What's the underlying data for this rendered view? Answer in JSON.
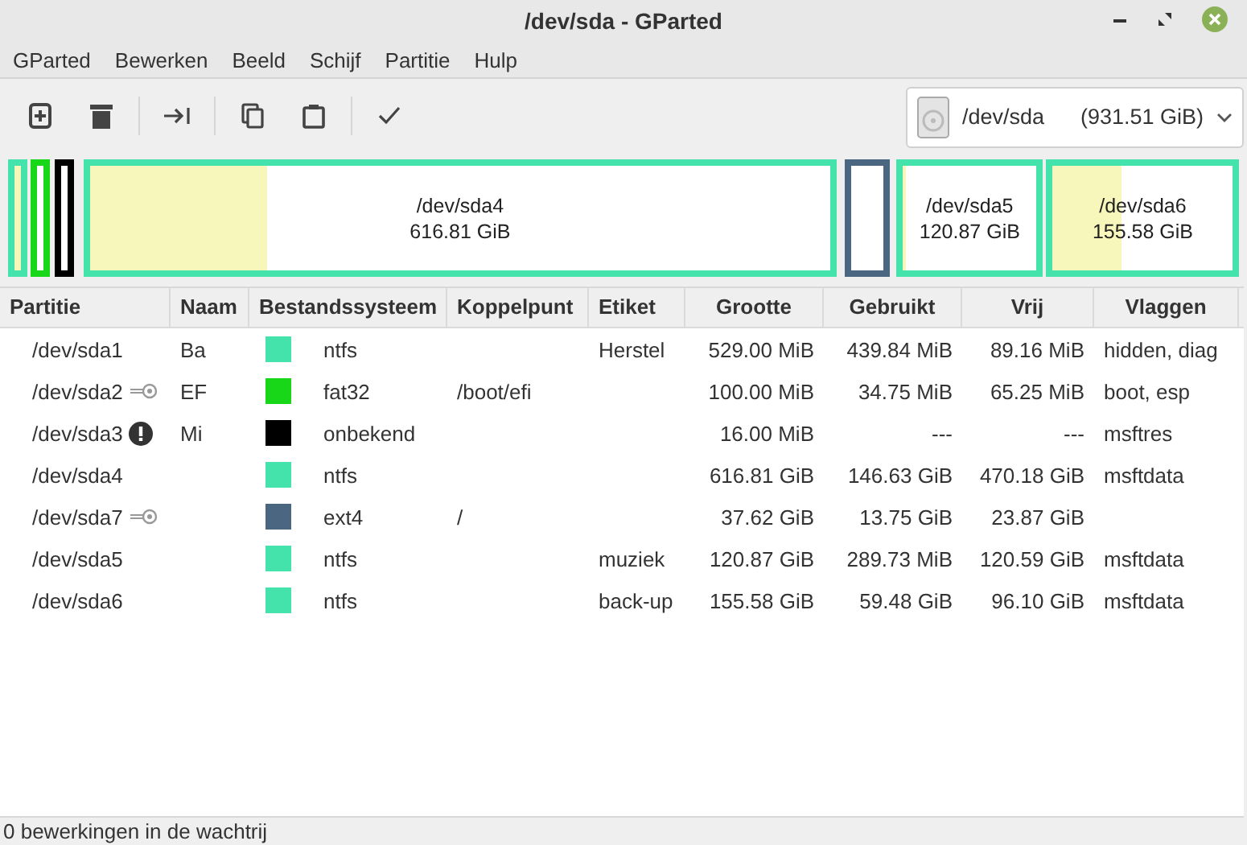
{
  "window": {
    "title": "/dev/sda - GParted"
  },
  "menu": [
    "GParted",
    "Bewerken",
    "Beeld",
    "Schijf",
    "Partitie",
    "Hulp"
  ],
  "device": {
    "name": "/dev/sda",
    "size": "(931.51 GiB)"
  },
  "disk_map": [
    {
      "color": "#43e3ab",
      "level": 1
    },
    {
      "color": "#18d718"
    },
    {
      "color": "#000000"
    },
    {
      "color": "#43e3ab",
      "level": 0.24,
      "name": "/dev/sda4",
      "size": "616.81 GiB"
    },
    {
      "color": "#4a6680"
    },
    {
      "color": "#43e3ab",
      "level": 0.02,
      "name": "/dev/sda5",
      "size": "120.87 GiB"
    },
    {
      "color": "#43e3ab",
      "level": 0.38,
      "name": "/dev/sda6",
      "size": "155.58 GiB"
    }
  ],
  "table": {
    "columns": [
      "Partitie",
      "Naam",
      "Bestandssysteem",
      "Koppelpunt",
      "Etiket",
      "Grootte",
      "Gebruikt",
      "Vrij",
      "Vlaggen"
    ],
    "rows": [
      {
        "partition": "/dev/sda1",
        "mounted": false,
        "warning": false,
        "name": "Ba",
        "color": "#43e3ab",
        "filesystem": "ntfs",
        "label": "Herstel",
        "size": "529.00 MiB",
        "used": "439.84 MiB",
        "free": "89.16 MiB",
        "flags": "hidden, diag"
      },
      {
        "partition": "/dev/sda2",
        "mounted": true,
        "warning": false,
        "name": "EF",
        "color": "#18d718",
        "filesystem": "fat32",
        "mountpoint": "/boot/efi",
        "size": "100.00 MiB",
        "used": "34.75 MiB",
        "free": "65.25 MiB",
        "flags": "boot, esp"
      },
      {
        "partition": "/dev/sda3",
        "mounted": false,
        "warning": true,
        "name": "Mi",
        "color": "#000000",
        "filesystem": "onbekend",
        "size": "16.00 MiB",
        "used": "---",
        "free": "---",
        "flags": "msftres"
      },
      {
        "partition": "/dev/sda4",
        "mounted": false,
        "warning": false,
        "color": "#43e3ab",
        "filesystem": "ntfs",
        "size": "616.81 GiB",
        "used": "146.63 GiB",
        "free": "470.18 GiB",
        "flags": "msftdata"
      },
      {
        "partition": "/dev/sda7",
        "mounted": true,
        "warning": false,
        "color": "#4a6680",
        "filesystem": "ext4",
        "mountpoint": "/",
        "size": "37.62 GiB",
        "used": "13.75 GiB",
        "free": "23.87 GiB"
      },
      {
        "partition": "/dev/sda5",
        "mounted": false,
        "warning": false,
        "color": "#43e3ab",
        "filesystem": "ntfs",
        "label": "muziek",
        "size": "120.87 GiB",
        "used": "289.73 MiB",
        "free": "120.59 GiB",
        "flags": "msftdata"
      },
      {
        "partition": "/dev/sda6",
        "mounted": false,
        "warning": false,
        "color": "#43e3ab",
        "filesystem": "ntfs",
        "label": "back-up",
        "size": "155.58 GiB",
        "used": "59.48 GiB",
        "free": "96.10 GiB",
        "flags": "msftdata"
      }
    ]
  },
  "status_bar": "0 bewerkingen in de wachtrij"
}
